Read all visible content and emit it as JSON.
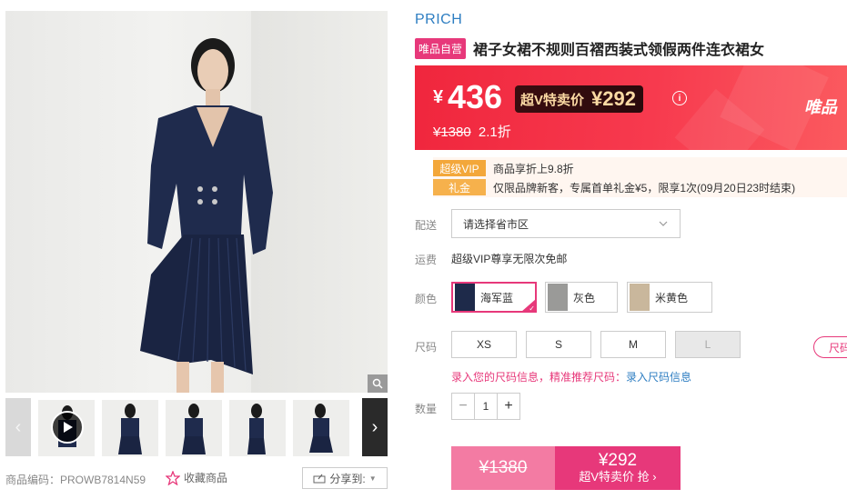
{
  "product": {
    "brand": "PRICH",
    "badge": "唯品自营",
    "title": "裙子女裙不规则百褶西装式领假两件连衣裙女"
  },
  "price": {
    "currency": "¥",
    "current": "436",
    "vip_label": "超V特卖价",
    "vip_price": "¥292",
    "original": "¥1380",
    "discount": "2.1折",
    "info_icon": "i",
    "banner_brand": "唯品"
  },
  "promotions": [
    {
      "tag": "超级VIP",
      "text": "商品享折上9.8折"
    },
    {
      "tag": "礼金",
      "text": "仅限品牌新客，专属首单礼金¥5，限享1次(09月20日23时结束)"
    }
  ],
  "delivery": {
    "label": "配送",
    "placeholder": "请选择省市区"
  },
  "shipping": {
    "label": "运费",
    "text": "超级VIP尊享无限次免邮"
  },
  "colors": {
    "label": "颜色",
    "options": [
      {
        "name": "海军蓝",
        "selected": true,
        "swatch": "#1e2a4a"
      },
      {
        "name": "灰色",
        "selected": false,
        "swatch": "#9a9a98"
      },
      {
        "name": "米黄色",
        "selected": false,
        "swatch": "#c9b79c"
      }
    ]
  },
  "sizes": {
    "label": "尺码",
    "options": [
      {
        "name": "XS",
        "available": true
      },
      {
        "name": "S",
        "available": true
      },
      {
        "name": "M",
        "available": true
      },
      {
        "name": "L",
        "available": false
      }
    ],
    "guide": "尺码",
    "hint": "录入您的尺码信息，精准推荐尺码：",
    "hint_link": "录入尺码信息"
  },
  "quantity": {
    "label": "数量",
    "value": "1",
    "minus": "−",
    "plus": "+"
  },
  "buy": {
    "original": "¥1380",
    "vip_price": "¥292",
    "vip_text": "超V特卖价 抢 ›"
  },
  "gallery": {
    "sku_label": "商品编码：PROWB7814N59",
    "favorite": "收藏商品",
    "share": "分享到:"
  },
  "colors_theme": {
    "accent": "#e7387a",
    "link": "#2e7ec2",
    "banner": "#f0263d",
    "vip_gold": "#fbd9a3"
  }
}
